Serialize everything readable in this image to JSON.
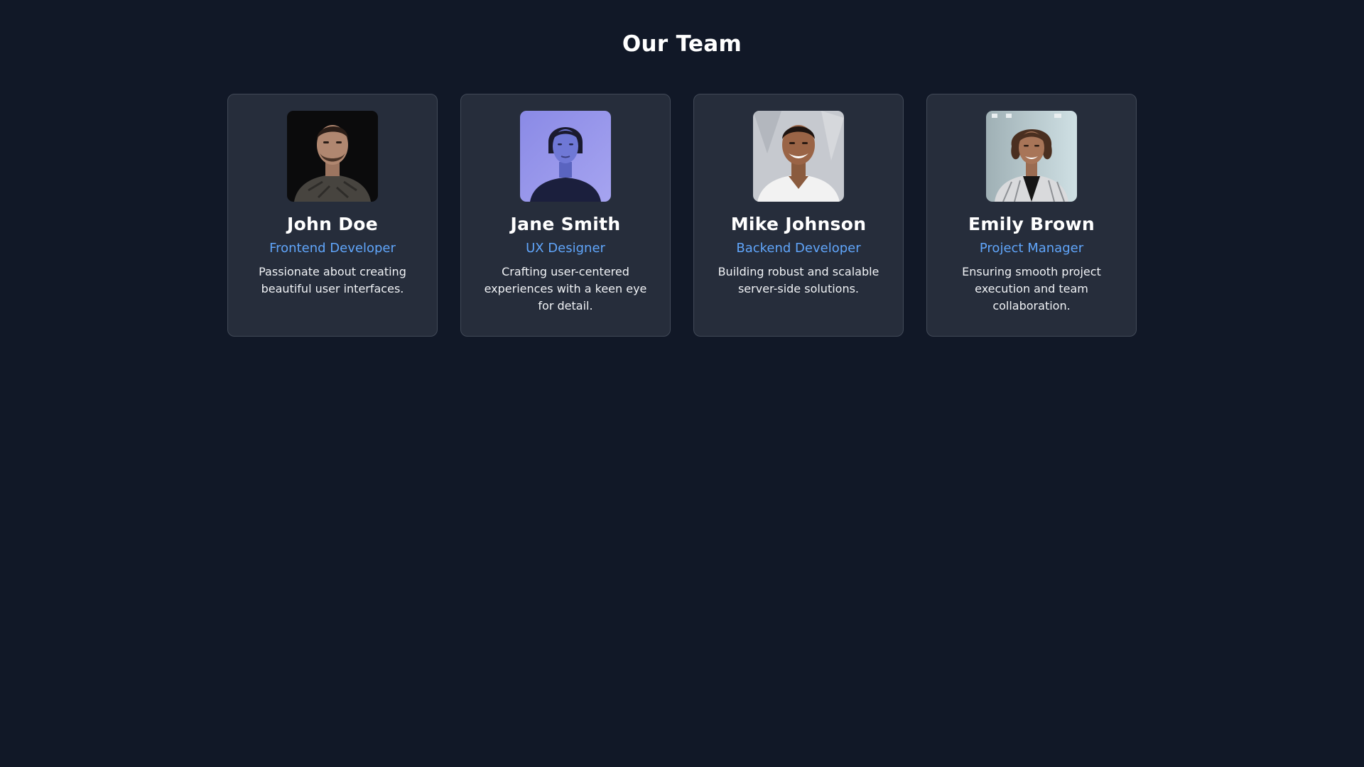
{
  "page": {
    "title": "Our Team"
  },
  "colors": {
    "background": "#111827",
    "card": "#262d3b",
    "card_border": "#414957",
    "accent": "#60a5fa"
  },
  "team": [
    {
      "name": "John Doe",
      "role": "Frontend Developer",
      "bio": "Passionate about creating beautiful user interfaces.",
      "photo": "john-doe-portrait"
    },
    {
      "name": "Jane Smith",
      "role": "UX Designer",
      "bio": "Crafting user-centered experiences with a keen eye for detail.",
      "photo": "jane-smith-portrait"
    },
    {
      "name": "Mike Johnson",
      "role": "Backend Developer",
      "bio": "Building robust and scalable server-side solutions.",
      "photo": "mike-johnson-portrait"
    },
    {
      "name": "Emily Brown",
      "role": "Project Manager",
      "bio": "Ensuring smooth project execution and team collaboration.",
      "photo": "emily-brown-portrait"
    }
  ]
}
